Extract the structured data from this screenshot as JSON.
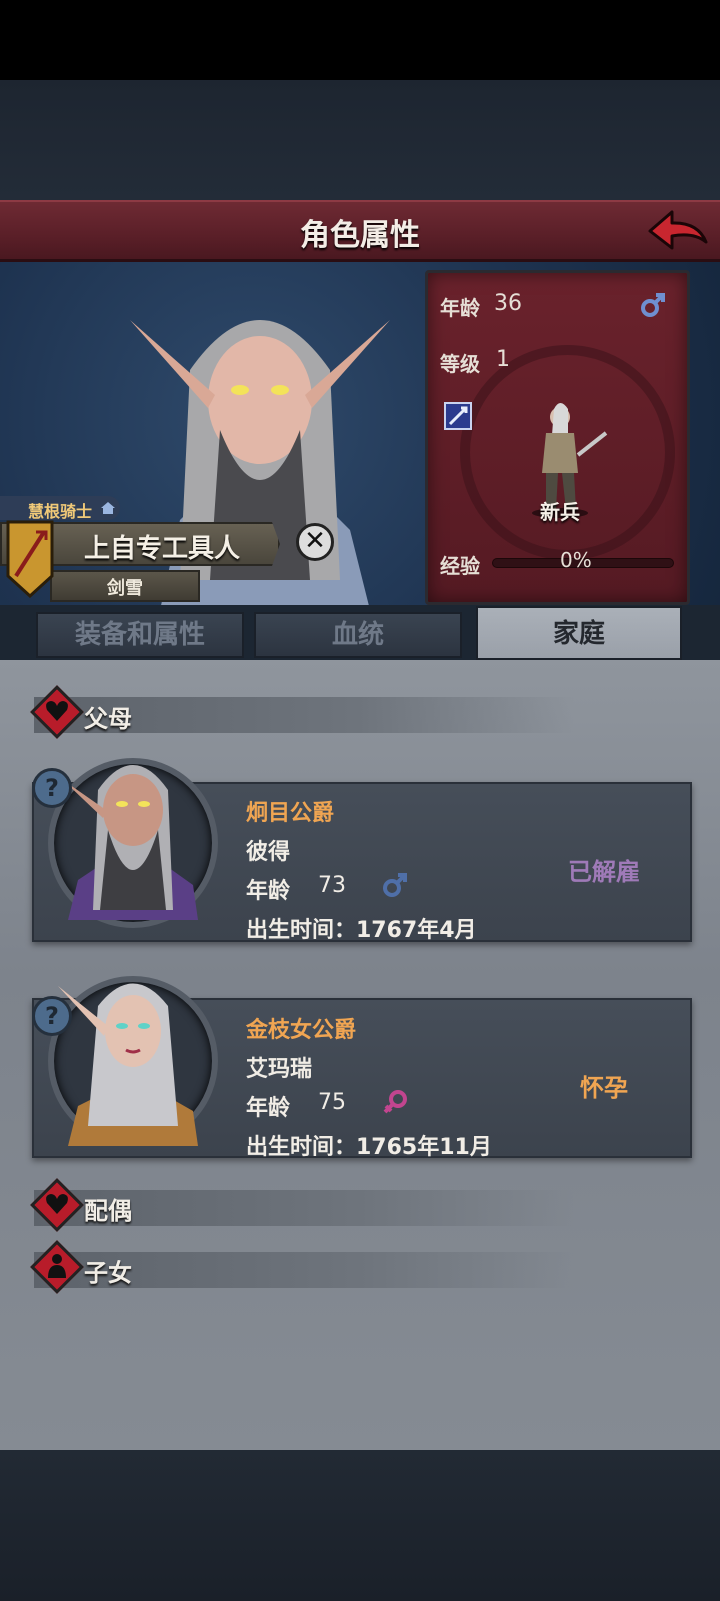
{
  "header": {
    "title": "角色属性"
  },
  "stats": {
    "age_label": "年龄",
    "age": "36",
    "level_label": "等级",
    "level": "1",
    "rank": "新兵",
    "exp_label": "经验",
    "exp": "0%",
    "exp_fraction": 0
  },
  "character": {
    "house": "慧根骑士",
    "name": "上自专工具人",
    "title": "剑雪"
  },
  "tabs": [
    {
      "label": "装备和属性",
      "active": false
    },
    {
      "label": "血统",
      "active": false
    },
    {
      "label": "家庭",
      "active": true
    }
  ],
  "family": {
    "parents_label": "父母",
    "spouse_label": "配偶",
    "children_label": "子女",
    "help_symbol": "?",
    "father": {
      "title": "炯目公爵",
      "name": "彼得",
      "age_label": "年龄",
      "age": "73",
      "gender": "male",
      "birth": "出生时间：1767年4月",
      "status": "已解雇"
    },
    "mother": {
      "title": "金枝女公爵",
      "name": "艾玛瑞",
      "age_label": "年龄",
      "age": "75",
      "gender": "female",
      "birth": "出生时间：1765年11月",
      "status": "怀孕"
    }
  },
  "colors": {
    "header": "#5a1f28",
    "accent_orange": "#f0a552",
    "status_purple": "#9f7ab8",
    "male": "#6f8fd0",
    "female": "#c2458f",
    "section_red": "#b81c2a"
  },
  "icons": {
    "back": "back-arrow-icon",
    "male": "male-symbol-icon",
    "female": "female-symbol-icon",
    "heart": "heart-icon",
    "child": "child-icon",
    "close": "close-icon",
    "shield": "sword-shield-icon"
  }
}
